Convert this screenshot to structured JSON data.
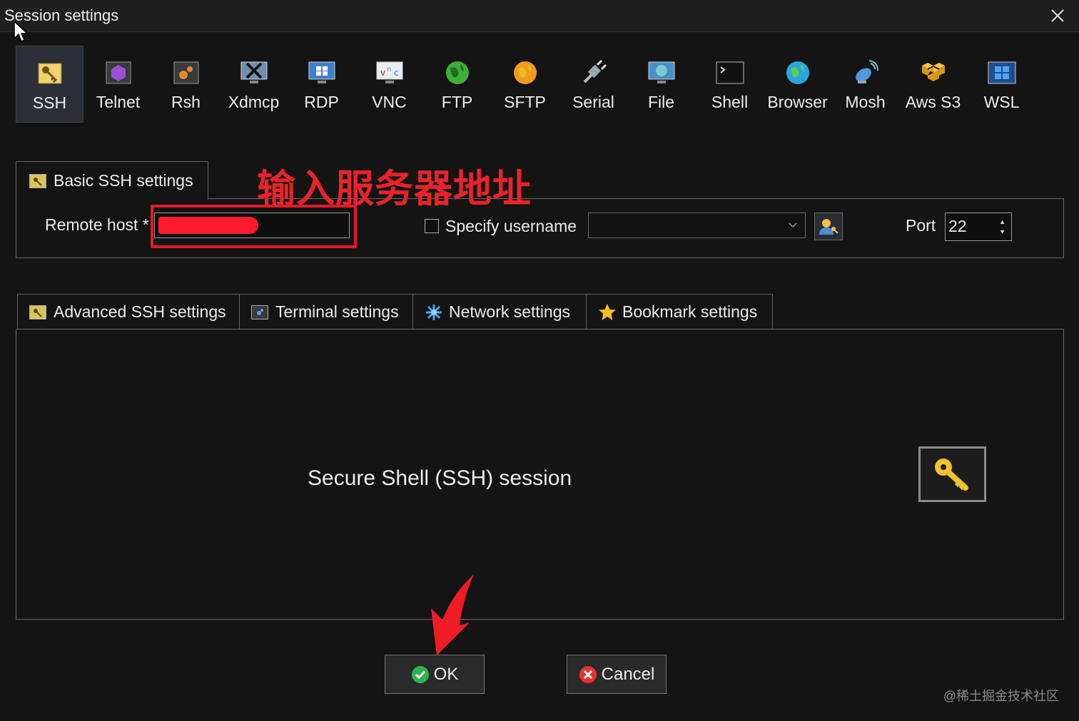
{
  "window": {
    "title": "Session settings"
  },
  "toolbar": {
    "items": [
      {
        "label": "SSH",
        "icon": "ssh-key-icon"
      },
      {
        "label": "Telnet",
        "icon": "telnet-icon"
      },
      {
        "label": "Rsh",
        "icon": "rsh-icon"
      },
      {
        "label": "Xdmcp",
        "icon": "xdmcp-icon"
      },
      {
        "label": "RDP",
        "icon": "rdp-icon"
      },
      {
        "label": "VNC",
        "icon": "vnc-icon"
      },
      {
        "label": "FTP",
        "icon": "ftp-globe-icon"
      },
      {
        "label": "SFTP",
        "icon": "sftp-globe-icon"
      },
      {
        "label": "Serial",
        "icon": "serial-plug-icon"
      },
      {
        "label": "File",
        "icon": "file-monitor-icon"
      },
      {
        "label": "Shell",
        "icon": "shell-terminal-icon"
      },
      {
        "label": "Browser",
        "icon": "browser-globe-icon"
      },
      {
        "label": "Mosh",
        "icon": "mosh-satellite-icon"
      },
      {
        "label": "Aws S3",
        "icon": "aws-s3-icon"
      },
      {
        "label": "WSL",
        "icon": "wsl-windows-icon"
      }
    ]
  },
  "basic": {
    "tab_label": "Basic SSH settings",
    "annotation": "输入服务器地址",
    "remote_host_label": "Remote host *",
    "remote_host_value": "",
    "specify_username_label": "Specify username",
    "port_label": "Port",
    "port_value": "22"
  },
  "settings_tabs": [
    {
      "label": "Advanced SSH settings",
      "icon": "ssh-key-icon"
    },
    {
      "label": "Terminal settings",
      "icon": "terminal-icon"
    },
    {
      "label": "Network settings",
      "icon": "network-star-icon"
    },
    {
      "label": "Bookmark settings",
      "icon": "bookmark-star-icon"
    }
  ],
  "panel": {
    "description": "Secure Shell (SSH) session"
  },
  "buttons": {
    "ok": "OK",
    "cancel": "Cancel"
  },
  "watermark": "@稀土掘金技术社区",
  "colors": {
    "accent_red": "#e21b2b",
    "background": "#141414",
    "gold": "#f2c22b"
  }
}
